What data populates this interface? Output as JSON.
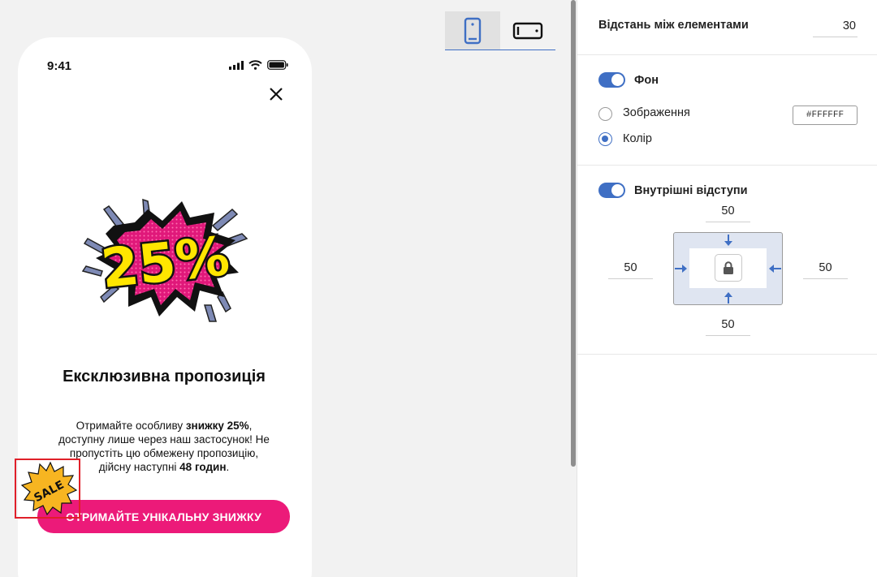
{
  "preview": {
    "device_switch": {
      "mobile_icon": "mobile-icon",
      "desktop_icon": "desktop-icon",
      "active": "mobile"
    },
    "phone": {
      "status_time": "9:41",
      "status_icons": [
        "signal-icon",
        "wifi-icon",
        "battery-icon"
      ],
      "close_icon": "close-icon",
      "image_text": "25%",
      "title": "Ексклюзивна пропозиція",
      "text_parts": {
        "p1": "Отримайте особливу ",
        "b1": "знижку 25%",
        "p2": ", доступну лише через наш застосунок! Не пропустіть цю обмежену пропозицію, дійсну наступні ",
        "b2": "48 годин",
        "p3": "."
      },
      "cta_label": "ОТРИМАЙТЕ УНІКАЛЬНУ ЗНИЖКУ",
      "sale_badge": "SALE",
      "cta_color": "#ec1a79"
    }
  },
  "settings": {
    "spacing": {
      "label": "Відстань між елементами",
      "value": "30"
    },
    "background": {
      "toggle_on": true,
      "label": "Фон",
      "options": [
        {
          "label": "Зображення",
          "checked": false
        },
        {
          "label": "Колір",
          "checked": true
        }
      ],
      "color_value": "#FFFFFF"
    },
    "padding": {
      "toggle_on": true,
      "label": "Внутрішні відступи",
      "top": "50",
      "left": "50",
      "right": "50",
      "bottom": "50",
      "lock_icon": "lock-icon"
    },
    "accent_color": "#3f6fc4"
  }
}
